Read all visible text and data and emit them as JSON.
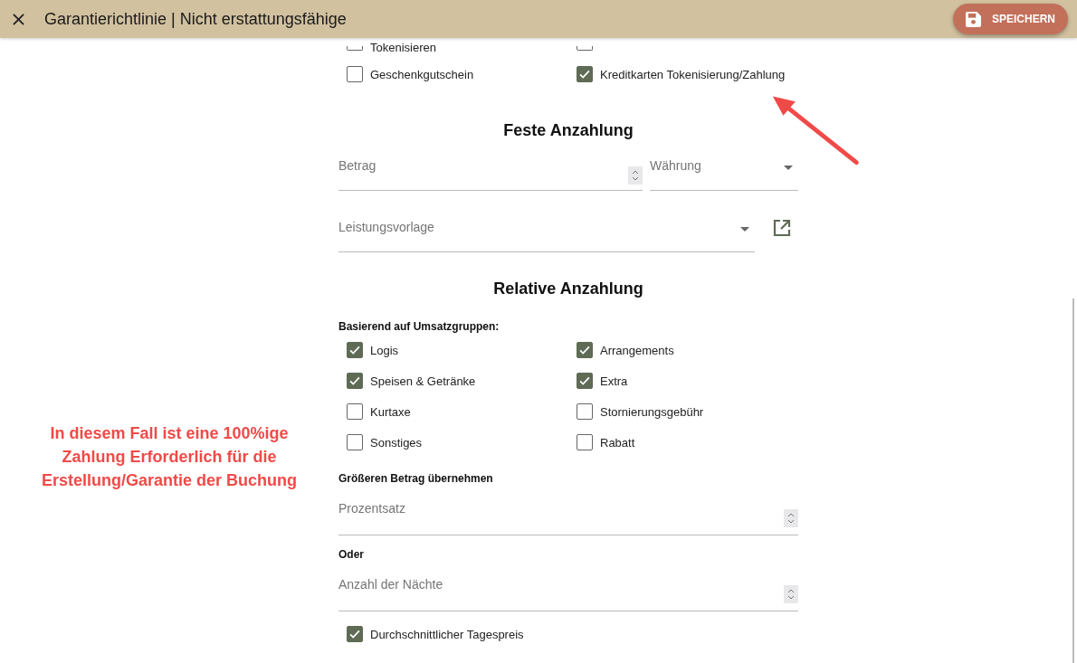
{
  "header": {
    "title": "Garantierichtlinie | Nicht erstattungsfähige",
    "save_button": "SPEICHERN"
  },
  "payment_methods": [
    {
      "label": "Tokenisieren",
      "checked": false
    },
    {
      "checked": false
    },
    {
      "label": "Geschenkgutschein",
      "checked": false
    },
    {
      "label": "Kreditkarten Tokenisierung/Zahlung",
      "checked": true
    }
  ],
  "fixed_deposit": {
    "title": "Feste Anzahlung",
    "fields": [
      {
        "kind": "number",
        "placeholder": "Betrag"
      },
      {
        "kind": "select",
        "placeholder": "Währung"
      }
    ],
    "service_template": {
      "placeholder": "Leistungsvorlage"
    }
  },
  "relative_deposit": {
    "title": "Relative Anzahlung",
    "group_label": "Basierend auf Umsatzgruppen:",
    "groups": [
      {
        "label": "Logis",
        "checked": true
      },
      {
        "label": "Arrangements",
        "checked": true
      },
      {
        "label": "Speisen & Getränke",
        "checked": true
      },
      {
        "label": "Extra",
        "checked": true
      },
      {
        "label": "Kurtaxe",
        "checked": false
      },
      {
        "label": "Stornierungsgebühr",
        "checked": false
      },
      {
        "label": "Sonstiges",
        "checked": false
      },
      {
        "label": "Rabatt",
        "checked": false
      }
    ],
    "larger_label": "Größeren Betrag übernehmen",
    "percentage": {
      "placeholder": "Prozentsatz"
    },
    "or_label": "Oder",
    "nights": {
      "placeholder": "Anzahl der Nächte"
    },
    "average_rate": {
      "label": "Durchschnittlicher Tagespreis",
      "checked": true
    }
  },
  "annotation": {
    "text": "In diesem Fall ist eine 100%ige Zahlung Erforderlich für die Erstellung/Garantie der Buchung"
  }
}
